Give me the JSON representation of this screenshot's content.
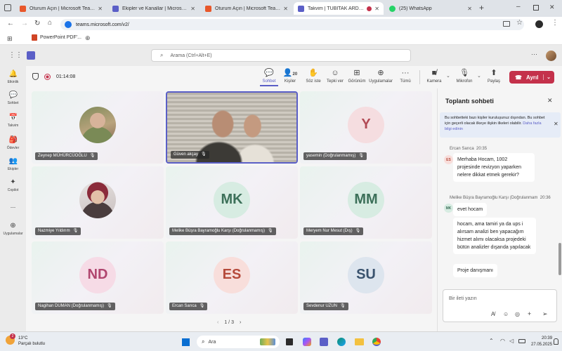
{
  "browser": {
    "tabs": [
      {
        "title": "Oturum Açın | Microsoft Teams",
        "color": "#e8572a"
      },
      {
        "title": "Ekipler ve Kanallar | Microsoft T",
        "color": "#5b5fc7"
      },
      {
        "title": "Oturum Açın | Microsoft Teams",
        "color": "#e8572a"
      },
      {
        "title": "Takvim | TÜBİTAK ARDEB D",
        "color": "#5b5fc7"
      },
      {
        "title": "(25) WhatsApp",
        "color": "#25d366"
      }
    ],
    "url": "teams.microsoft.com/v2/",
    "bookmark": "PowerPoint PDF'..."
  },
  "teams": {
    "search_placeholder": "Arama (Ctrl+Alt+E)",
    "rail": [
      {
        "label": "Etkinlik",
        "icon": "bell-icon",
        "glyph": "🔔"
      },
      {
        "label": "Sohbet",
        "icon": "chat-icon",
        "glyph": "💬"
      },
      {
        "label": "Takvim",
        "icon": "calendar-icon",
        "glyph": "📅"
      },
      {
        "label": "Ödevler",
        "icon": "assignment-icon",
        "glyph": "🎒"
      },
      {
        "label": "Ekipler",
        "icon": "teams-icon",
        "glyph": "👥"
      },
      {
        "label": "Copilot",
        "icon": "copilot-icon",
        "glyph": "✦"
      },
      {
        "label": "...",
        "icon": "more-icon",
        "glyph": ""
      },
      {
        "label": "Uygulamalar",
        "icon": "apps-icon",
        "glyph": "⊕"
      }
    ]
  },
  "meeting": {
    "timer": "01:14:08",
    "people_count": "20",
    "toolbar": {
      "chat": "Sohbet",
      "people": "Kişiler",
      "raise": "Söz iste",
      "react": "Tepki ver",
      "view": "Görünüm",
      "apps": "Uygulamalar",
      "more": "Tümü",
      "camera": "Kamera",
      "mic": "Mikrofon",
      "share": "Paylaş",
      "leave": "Ayrıl"
    },
    "participants": [
      {
        "name": "Zeynep MÜHÜRCÜOĞLU",
        "initials": "",
        "photo": true
      },
      {
        "name": "Güven akçay",
        "initials": "",
        "video": true
      },
      {
        "name": "yasemin (Doğrulanmamış)",
        "initials": "Y",
        "bg": "#f5dde0",
        "fg": "#b24a55"
      },
      {
        "name": "Nazmiye Yıldırım",
        "initials": "",
        "photo": true
      },
      {
        "name": "Melike Büşra Bayramoğlu Karşı (Doğrulanmamış)",
        "initials": "MK",
        "bg": "#d7ece2",
        "fg": "#3c7059"
      },
      {
        "name": "Meryem Nur Mesut (Dış)",
        "initials": "MM",
        "bg": "#d7ece2",
        "fg": "#3c7059"
      },
      {
        "name": "Nagihan DUMAN (Doğrulanmamış)",
        "initials": "ND",
        "bg": "#f6dbe6",
        "fg": "#b0466f"
      },
      {
        "name": "Ercan Sarıca",
        "initials": "ES",
        "bg": "#f8dedb",
        "fg": "#b54a3b"
      },
      {
        "name": "Sevdenur UZUN",
        "initials": "SU",
        "bg": "#dde5ee",
        "fg": "#3a536e"
      }
    ],
    "pagination": "1 / 3"
  },
  "chat": {
    "title": "Toplantı sohbeti",
    "banner": "Bu sohbetteki bazı kişiler kuruluşunuz dışından. Bu sohbet için geçerli olacak ilkeye ilişkin ilkeleri",
    "banner_tail": "olabilir.",
    "banner_link": "Daha fazla bilgi edinin",
    "messages": [
      {
        "sender": "Ercan Sarıca",
        "time": "20:35",
        "initials": "ES",
        "text": "Merhaba Hocam, 1002 projesinde revizyon yaparken nelere dikkat etmek gerekir?"
      },
      {
        "sender": "Melike Büşra Bayramoğlu Karşı (Doğrulanmam",
        "time": "20:36",
        "initials": "MK",
        "texts": [
          "evet hocam",
          "hocam, ama tamiri ya da ups i alırsam analizi ben yapacağım hizmet alımı olacaksa projedeki bütün analizler dışarıda yapılacak",
          "Proje danışmanı"
        ]
      }
    ],
    "compose_placeholder": "Bir ileti yazın"
  },
  "taskbar": {
    "weather_temp": "13°C",
    "weather_desc": "Parçalı bulutlu",
    "weather_badge": "2",
    "search": "Ara",
    "time": "20:39",
    "date": "27.05.2025"
  }
}
